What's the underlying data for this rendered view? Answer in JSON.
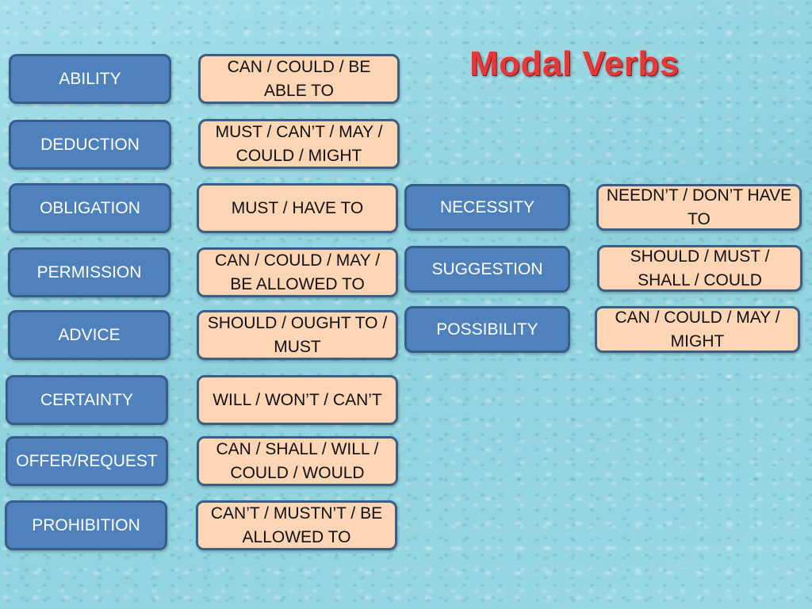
{
  "title": "Modal Verbs",
  "colors": {
    "title": "#e23a3a",
    "category_fill": "#4f81bd",
    "category_border": "#385d8a",
    "verb_fill": "#fcd5b5",
    "verb_border": "#3b5f86"
  },
  "left_column": [
    {
      "category": "ABILITY",
      "verbs": "CAN / COULD / BE ABLE TO"
    },
    {
      "category": "DEDUCTION",
      "verbs": "MUST / CAN’T / MAY / COULD / MIGHT"
    },
    {
      "category": "OBLIGATION",
      "verbs": "MUST / HAVE TO"
    },
    {
      "category": "PERMISSION",
      "verbs": "CAN / COULD / MAY / BE ALLOWED TO"
    },
    {
      "category": "ADVICE",
      "verbs": "SHOULD / OUGHT TO / MUST"
    },
    {
      "category": "CERTAINTY",
      "verbs": "WILL / WON’T / CAN’T"
    },
    {
      "category": "OFFER/REQUEST",
      "verbs": "CAN / SHALL / WILL / COULD / WOULD"
    },
    {
      "category": "PROHIBITION",
      "verbs": "CAN’T / MUSTN’T / BE ALLOWED TO"
    }
  ],
  "right_column": [
    {
      "category": "NECESSITY",
      "verbs": "NEEDN’T / DON’T HAVE TO"
    },
    {
      "category": "SUGGESTION",
      "verbs": "SHOULD / MUST / SHALL / COULD"
    },
    {
      "category": "POSSIBILITY",
      "verbs": "CAN / COULD / MAY / MIGHT"
    }
  ]
}
